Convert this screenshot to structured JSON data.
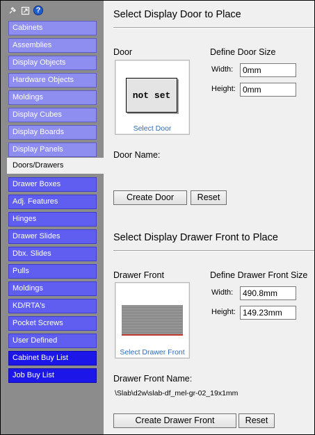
{
  "sidebar": {
    "items": [
      {
        "label": "Cabinets"
      },
      {
        "label": "Assemblies"
      },
      {
        "label": "Display Objects"
      },
      {
        "label": "Hardware Objects"
      },
      {
        "label": "Moldings"
      },
      {
        "label": "Display Cubes"
      },
      {
        "label": "Display Boards"
      },
      {
        "label": "Display Panels"
      },
      {
        "label": "Doors/Drawers"
      },
      {
        "label": "Drawer Boxes"
      },
      {
        "label": "Adj. Features"
      },
      {
        "label": "Hinges"
      },
      {
        "label": "Drawer Slides"
      },
      {
        "label": "Dbx. Slides"
      },
      {
        "label": "Pulls"
      },
      {
        "label": "Moldings"
      },
      {
        "label": "KD/RTA's"
      },
      {
        "label": "Pocket Screws"
      },
      {
        "label": "User Defined"
      },
      {
        "label": "Cabinet Buy List"
      },
      {
        "label": "Job Buy List"
      }
    ],
    "active_item": "Doors/Drawers",
    "icons": [
      "pin-icon",
      "window-icon",
      "help-icon"
    ],
    "help_glyph": "?"
  },
  "door": {
    "section_title": "Select Display Door to Place",
    "preview_label": "Door",
    "size_title": "Define Door Size",
    "width_label": "Width:",
    "width_value": "0mm",
    "height_label": "Height:",
    "height_value": "0mm",
    "placeholder_text": "not set",
    "select_link": "Select Door",
    "name_label": "Door Name:",
    "name_value": "",
    "create_button": "Create Door",
    "reset_button": "Reset"
  },
  "drawer": {
    "section_title": "Select Display Drawer Front to Place",
    "preview_label": "Drawer Front",
    "size_title": "Define Drawer Front Size",
    "width_label": "Width:",
    "width_value": "490.8mm",
    "height_label": "Height:",
    "height_value": "149.23mm",
    "select_link": "Select Drawer Front",
    "name_label": "Drawer Front Name:",
    "name_value": "\\Slab\\d2w\\slab-df_mel-gr-02_19x1mm",
    "create_button": "Create Drawer Front",
    "reset_button": "Reset"
  },
  "colors": {
    "sidebar_bg": "#8c8c8c",
    "nav_light": "#8e8df0",
    "nav_medium": "#5f5ef0",
    "nav_dark": "#1c17e8",
    "link": "#2e6bb8"
  }
}
